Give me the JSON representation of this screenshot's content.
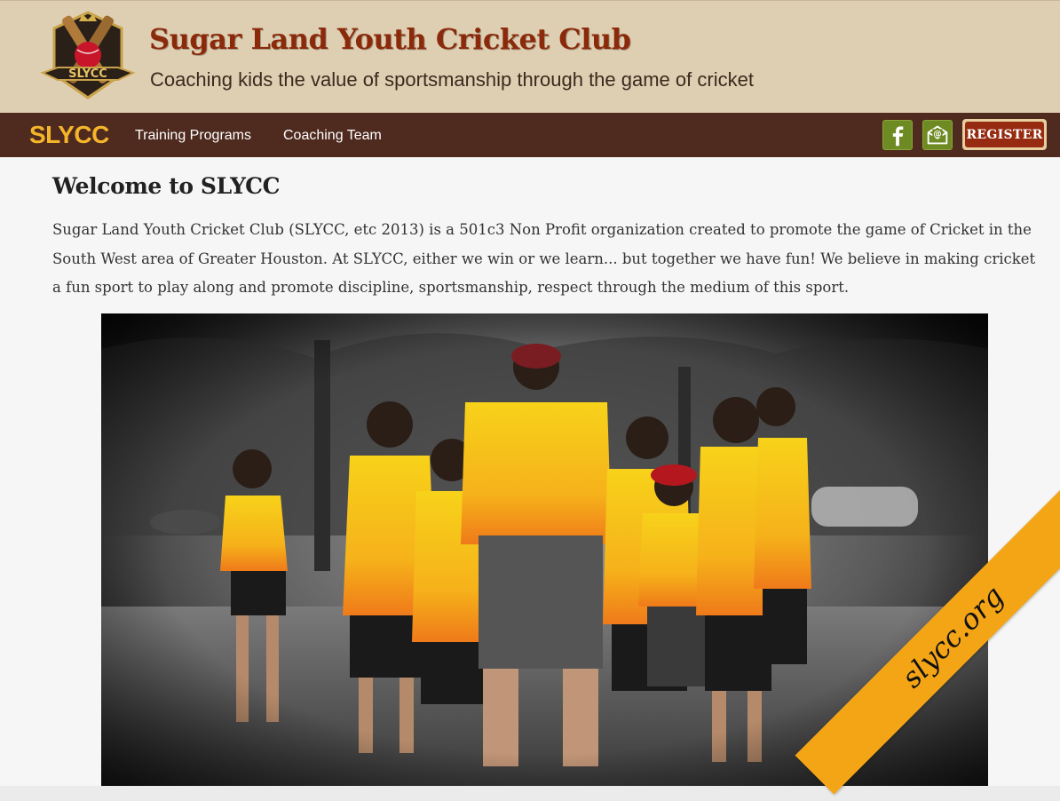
{
  "header": {
    "title": "Sugar Land Youth Cricket Club",
    "tagline": "Coaching kids the value of sportsmanship through the game of cricket",
    "logo_text": "SLYCC"
  },
  "nav": {
    "brand": "SLYCC",
    "links": [
      {
        "label": "Training Programs"
      },
      {
        "label": "Coaching Team"
      }
    ],
    "icons": [
      "facebook-icon",
      "email-icon"
    ],
    "register_label": "REGISTER"
  },
  "main": {
    "heading": "Welcome to SLYCC",
    "intro": "Sugar Land Youth Cricket Club (SLYCC, etc 2013) is a 501c3 Non Profit organization created to promote the game of Cricket in the South West area of Greater Houston. At SLYCC, either we win or we learn... but together we have fun! We believe in making cricket a fun sport to play along and promote discipline, sportsmanship, respect through the medium of this sport."
  },
  "ribbon": {
    "label": "slycc.org"
  },
  "colors": {
    "masthead": "#dfcfb2",
    "title": "#8b2a0b",
    "navbar": "#4f2a1e",
    "brand": "#f5b52b",
    "social": "#6e8a23",
    "register": "#962b11",
    "ribbon": "#f4a516",
    "jersey": "#f7c41a"
  }
}
